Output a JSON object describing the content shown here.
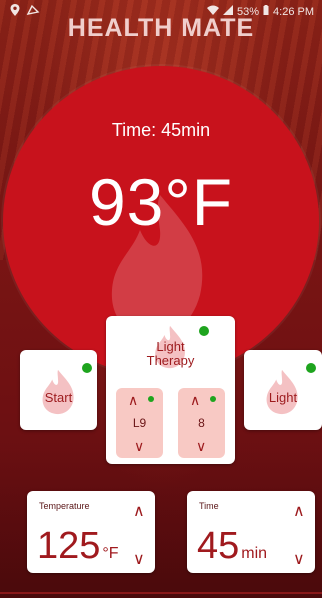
{
  "status_bar": {
    "battery": "53%",
    "clock": "4:26 PM"
  },
  "app": {
    "logo_text": "HEALTH MATE"
  },
  "display": {
    "time_text": "Time: 45min",
    "temperature_text": "93°F"
  },
  "controls": {
    "start_label": "Start",
    "light_therapy_label": "Light Therapy",
    "light_label": "Light",
    "left_level": "L9",
    "right_level": "8"
  },
  "settings": {
    "temperature_label": "Temperature",
    "temperature_value": "125",
    "temperature_unit": "°F",
    "time_label": "Time",
    "time_value": "45",
    "time_unit": "min"
  },
  "colors": {
    "accent": "#c8121c",
    "status_dot": "#1ea41e",
    "subcard": "#f8c9c4"
  }
}
